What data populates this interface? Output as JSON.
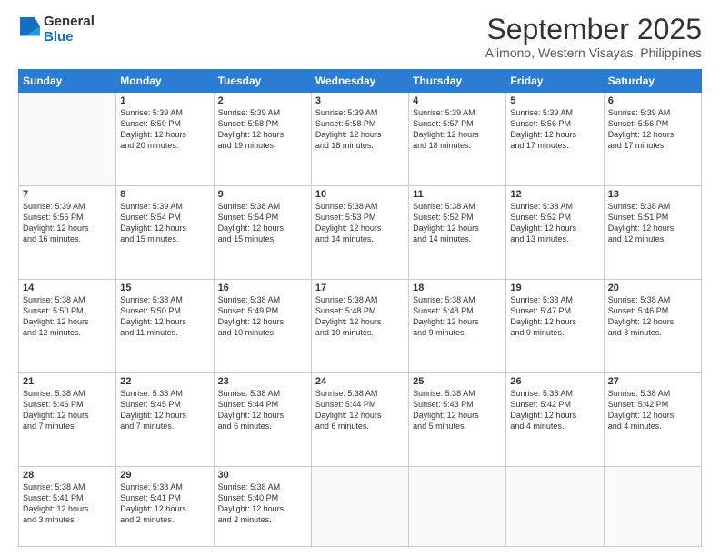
{
  "header": {
    "logo_general": "General",
    "logo_blue": "Blue",
    "month": "September 2025",
    "location": "Alimono, Western Visayas, Philippines"
  },
  "weekdays": [
    "Sunday",
    "Monday",
    "Tuesday",
    "Wednesday",
    "Thursday",
    "Friday",
    "Saturday"
  ],
  "weeks": [
    [
      {
        "day": "",
        "info": ""
      },
      {
        "day": "1",
        "info": "Sunrise: 5:39 AM\nSunset: 5:59 PM\nDaylight: 12 hours\nand 20 minutes."
      },
      {
        "day": "2",
        "info": "Sunrise: 5:39 AM\nSunset: 5:58 PM\nDaylight: 12 hours\nand 19 minutes."
      },
      {
        "day": "3",
        "info": "Sunrise: 5:39 AM\nSunset: 5:58 PM\nDaylight: 12 hours\nand 18 minutes."
      },
      {
        "day": "4",
        "info": "Sunrise: 5:39 AM\nSunset: 5:57 PM\nDaylight: 12 hours\nand 18 minutes."
      },
      {
        "day": "5",
        "info": "Sunrise: 5:39 AM\nSunset: 5:56 PM\nDaylight: 12 hours\nand 17 minutes."
      },
      {
        "day": "6",
        "info": "Sunrise: 5:39 AM\nSunset: 5:56 PM\nDaylight: 12 hours\nand 17 minutes."
      }
    ],
    [
      {
        "day": "7",
        "info": "Sunrise: 5:39 AM\nSunset: 5:55 PM\nDaylight: 12 hours\nand 16 minutes."
      },
      {
        "day": "8",
        "info": "Sunrise: 5:39 AM\nSunset: 5:54 PM\nDaylight: 12 hours\nand 15 minutes."
      },
      {
        "day": "9",
        "info": "Sunrise: 5:38 AM\nSunset: 5:54 PM\nDaylight: 12 hours\nand 15 minutes."
      },
      {
        "day": "10",
        "info": "Sunrise: 5:38 AM\nSunset: 5:53 PM\nDaylight: 12 hours\nand 14 minutes."
      },
      {
        "day": "11",
        "info": "Sunrise: 5:38 AM\nSunset: 5:52 PM\nDaylight: 12 hours\nand 14 minutes."
      },
      {
        "day": "12",
        "info": "Sunrise: 5:38 AM\nSunset: 5:52 PM\nDaylight: 12 hours\nand 13 minutes."
      },
      {
        "day": "13",
        "info": "Sunrise: 5:38 AM\nSunset: 5:51 PM\nDaylight: 12 hours\nand 12 minutes."
      }
    ],
    [
      {
        "day": "14",
        "info": "Sunrise: 5:38 AM\nSunset: 5:50 PM\nDaylight: 12 hours\nand 12 minutes."
      },
      {
        "day": "15",
        "info": "Sunrise: 5:38 AM\nSunset: 5:50 PM\nDaylight: 12 hours\nand 11 minutes."
      },
      {
        "day": "16",
        "info": "Sunrise: 5:38 AM\nSunset: 5:49 PM\nDaylight: 12 hours\nand 10 minutes."
      },
      {
        "day": "17",
        "info": "Sunrise: 5:38 AM\nSunset: 5:48 PM\nDaylight: 12 hours\nand 10 minutes."
      },
      {
        "day": "18",
        "info": "Sunrise: 5:38 AM\nSunset: 5:48 PM\nDaylight: 12 hours\nand 9 minutes."
      },
      {
        "day": "19",
        "info": "Sunrise: 5:38 AM\nSunset: 5:47 PM\nDaylight: 12 hours\nand 9 minutes."
      },
      {
        "day": "20",
        "info": "Sunrise: 5:38 AM\nSunset: 5:46 PM\nDaylight: 12 hours\nand 8 minutes."
      }
    ],
    [
      {
        "day": "21",
        "info": "Sunrise: 5:38 AM\nSunset: 5:46 PM\nDaylight: 12 hours\nand 7 minutes."
      },
      {
        "day": "22",
        "info": "Sunrise: 5:38 AM\nSunset: 5:45 PM\nDaylight: 12 hours\nand 7 minutes."
      },
      {
        "day": "23",
        "info": "Sunrise: 5:38 AM\nSunset: 5:44 PM\nDaylight: 12 hours\nand 6 minutes."
      },
      {
        "day": "24",
        "info": "Sunrise: 5:38 AM\nSunset: 5:44 PM\nDaylight: 12 hours\nand 6 minutes."
      },
      {
        "day": "25",
        "info": "Sunrise: 5:38 AM\nSunset: 5:43 PM\nDaylight: 12 hours\nand 5 minutes."
      },
      {
        "day": "26",
        "info": "Sunrise: 5:38 AM\nSunset: 5:42 PM\nDaylight: 12 hours\nand 4 minutes."
      },
      {
        "day": "27",
        "info": "Sunrise: 5:38 AM\nSunset: 5:42 PM\nDaylight: 12 hours\nand 4 minutes."
      }
    ],
    [
      {
        "day": "28",
        "info": "Sunrise: 5:38 AM\nSunset: 5:41 PM\nDaylight: 12 hours\nand 3 minutes."
      },
      {
        "day": "29",
        "info": "Sunrise: 5:38 AM\nSunset: 5:41 PM\nDaylight: 12 hours\nand 2 minutes."
      },
      {
        "day": "30",
        "info": "Sunrise: 5:38 AM\nSunset: 5:40 PM\nDaylight: 12 hours\nand 2 minutes."
      },
      {
        "day": "",
        "info": ""
      },
      {
        "day": "",
        "info": ""
      },
      {
        "day": "",
        "info": ""
      },
      {
        "day": "",
        "info": ""
      }
    ]
  ]
}
